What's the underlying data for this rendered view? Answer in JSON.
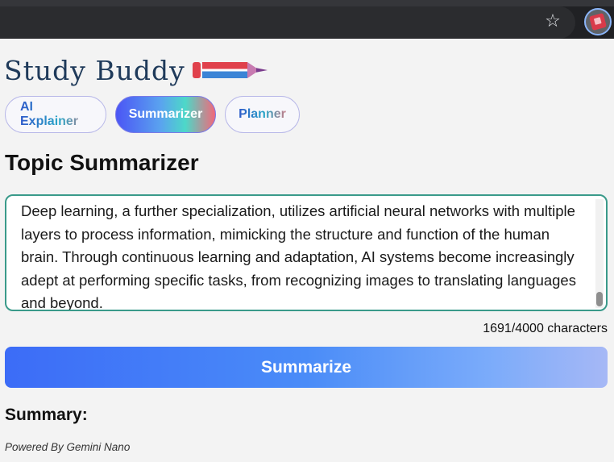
{
  "browser": {
    "star_glyph": "☆",
    "extension_icon": "study-buddy-extension-icon"
  },
  "app": {
    "logo_text": "Study Buddy",
    "logo_icon": "pencil-icon",
    "brand_colors": {
      "pencil_red": "#e0414c",
      "pencil_blue": "#3b84d6",
      "pencil_tip": "#a45aa6"
    }
  },
  "tabs": [
    {
      "label": "AI Explainer",
      "active": false
    },
    {
      "label": "Summarizer",
      "active": true
    },
    {
      "label": "Planner",
      "active": false
    }
  ],
  "main": {
    "title": "Topic Summarizer",
    "input_text": "Deep learning, a further specialization, utilizes artificial neural networks with multiple layers to process information, mimicking the structure and function of the human brain. Through continuous learning and adaptation, AI systems become increasingly adept at performing specific tasks, from recognizing images to translating languages and beyond.",
    "char_count": "1691/4000 characters",
    "summarize_label": "Summarize",
    "summary_label": "Summary:",
    "powered_by": "Powered By Gemini Nano"
  }
}
